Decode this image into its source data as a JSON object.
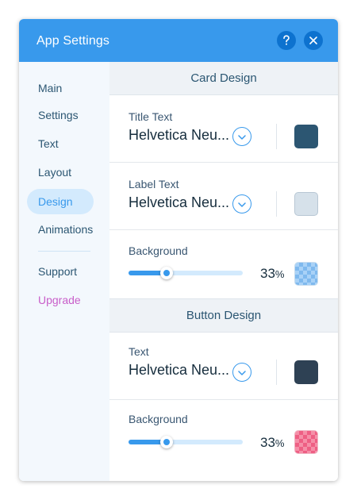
{
  "header": {
    "title": "App Settings",
    "help_icon": "question-icon",
    "close_icon": "close-icon",
    "accent": "#3899ec"
  },
  "sidebar": {
    "items": [
      {
        "label": "Main"
      },
      {
        "label": "Settings"
      },
      {
        "label": "Text"
      },
      {
        "label": "Layout"
      },
      {
        "label": "Design",
        "active": true
      },
      {
        "label": "Animations"
      }
    ],
    "footer_items": [
      {
        "label": "Support"
      },
      {
        "label": "Upgrade",
        "color": "#c85ec9"
      }
    ]
  },
  "card_design": {
    "section_title": "Card Design",
    "title_text": {
      "label": "Title Text",
      "font": "Helvetica Neu...",
      "color": "#2c5672"
    },
    "label_text": {
      "label": "Label Text",
      "font": "Helvetica Neu...",
      "color": "#d6e1ea"
    },
    "background": {
      "label": "Background",
      "opacity_value": "33",
      "opacity_unit": "%",
      "opacity_fraction": 0.33,
      "swatch": "checker-blue"
    }
  },
  "button_design": {
    "section_title": "Button Design",
    "text": {
      "label": "Text",
      "font": "Helvetica Neu...",
      "color": "#2e4154"
    },
    "background": {
      "label": "Background",
      "opacity_value": "33",
      "opacity_unit": "%",
      "opacity_fraction": 0.33,
      "swatch": "checker-pink"
    }
  }
}
